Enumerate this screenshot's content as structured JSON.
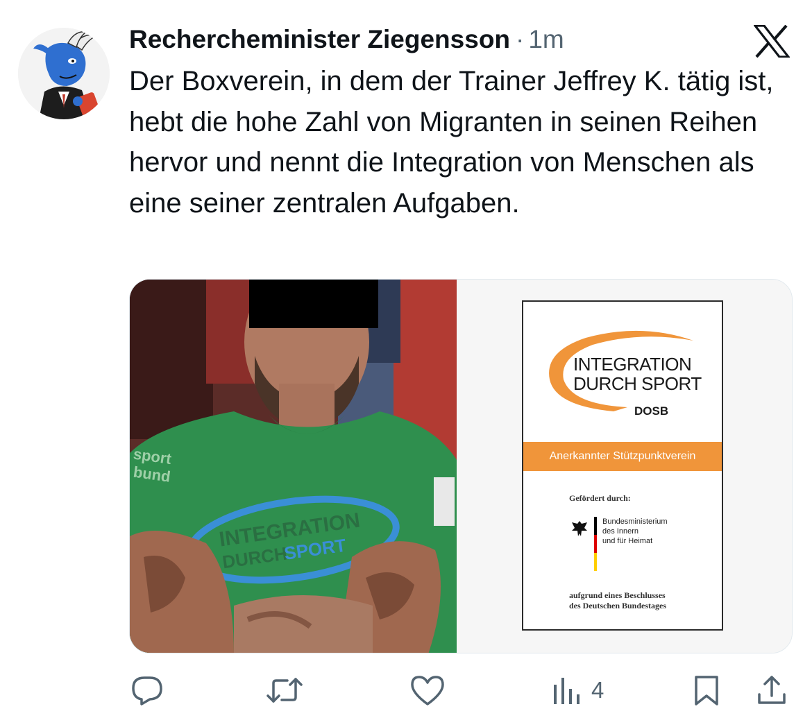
{
  "tweet": {
    "author_name": "Recherchеminister Ziegensson",
    "separator": "·",
    "timestamp": "1m",
    "text": "Der Boxverein, in dem der Trainer Jeffrey K. tätig ist, hebt die hohe Zahl von Migranten in seinen Reihen hervor und nennt die Integration von Menschen als eine seiner zentralen Aufgaben."
  },
  "media": {
    "left_photo": {
      "shirt_text_1": "INTEGRATION",
      "shirt_text_2": "DURCH",
      "shirt_text_3": "SPORT",
      "sleeve_text_1": "sport",
      "sleeve_text_2": "bund"
    },
    "poster": {
      "logo_line_1": "INTEGRATION",
      "logo_line_2": "DURCH SPORT",
      "org": "DOSB",
      "band": "Anerkannter Stützpunktverein",
      "funded_by": "Gefördert durch:",
      "ministry_line_1": "Bundesministerium",
      "ministry_line_2": "des Innern",
      "ministry_line_3": "und für Heimat",
      "decision_line_1": "aufgrund eines Beschlusses",
      "decision_line_2": "des Deutschen Bundestages"
    }
  },
  "actions": {
    "views_count": "4"
  },
  "colors": {
    "text": "#0f1419",
    "secondary": "#536471",
    "poster_orange": "#f0953a",
    "shirt_green": "#2f8f4e"
  },
  "icons": [
    "x-logo-icon",
    "reply-icon",
    "retweet-icon",
    "like-icon",
    "views-icon",
    "bookmark-icon",
    "share-icon"
  ]
}
